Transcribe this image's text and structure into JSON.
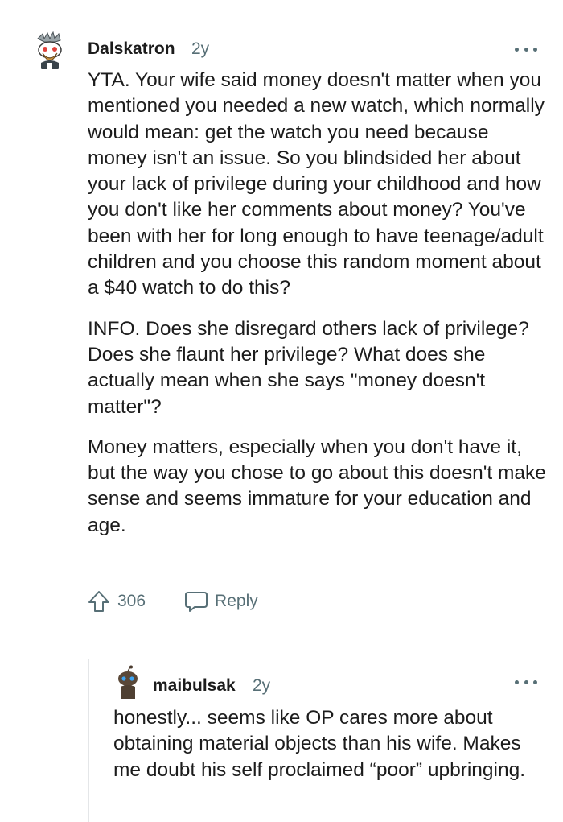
{
  "comments": [
    {
      "username": "Dalskatron",
      "age": "2y",
      "paragraphs": [
        "YTA. Your wife said money doesn't matter when you mentioned you needed a new watch, which normally would mean: get the watch you need because money isn't an issue. So you blindsided her about your lack of privilege during your childhood and how you don't like her comments about money? You've been with her for long enough to have teenage/adult children and you choose this random moment about a $40 watch to do this?",
        "INFO. Does she disregard others lack of privilege? Does she flaunt her privilege? What does she actually mean when she says \"money doesn't matter\"?",
        "Money matters, especially when you don't have it, but the way you chose to go about this doesn't make sense and seems immature for your education and age."
      ],
      "score": "306",
      "reply_label": "Reply"
    },
    {
      "username": "maibulsak",
      "age": "2y",
      "paragraphs": [
        "honestly... seems like OP cares more about obtaining material objects than his wife. Makes me doubt his self proclaimed “poor” upbringing."
      ]
    }
  ],
  "icons": {
    "more": "more-options-icon",
    "upvote": "upvote-arrow-icon",
    "reply": "comment-bubble-icon"
  },
  "colors": {
    "meta_text": "#576f76",
    "body_text": "#1c1c1c",
    "divider": "#e4e6e8"
  }
}
